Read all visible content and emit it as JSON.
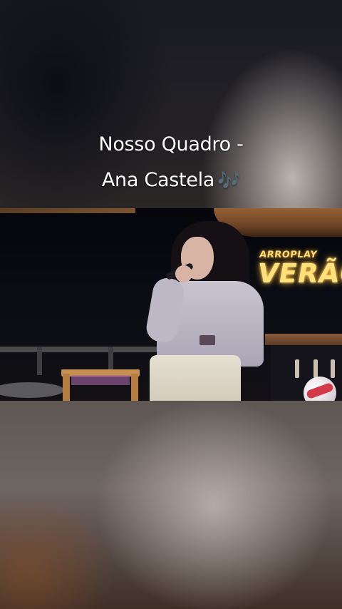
{
  "story": {
    "caption_line1": "Nosso Quadro -",
    "caption_line2": "Ana Castela",
    "caption_emoji": "🎶"
  },
  "video": {
    "sign_small": "ARROPLAY",
    "sign_big": "VERÃO"
  },
  "colors": {
    "caption_text": "#ffffff",
    "emoji_accent": "#a560e8",
    "neon_sign": "#ffe07a"
  }
}
